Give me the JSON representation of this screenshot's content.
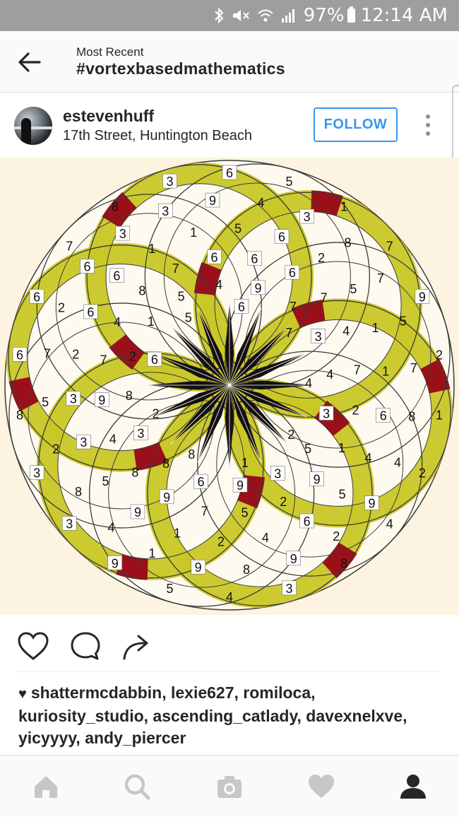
{
  "status_bar": {
    "battery": "97%",
    "time": "12:14 AM",
    "icons": [
      "bluetooth-icon",
      "mute-icon",
      "wifi-icon",
      "signal-icon",
      "battery-icon"
    ]
  },
  "header": {
    "subtitle": "Most Recent",
    "title": "#vortexbasedmathematics",
    "back_icon": "arrow-left-icon"
  },
  "post": {
    "username": "estevenhuff",
    "location": "17th Street, Huntington Beach",
    "follow_label": "FOLLOW",
    "more_icon": "vertical-dots-icon",
    "image": {
      "type": "vortex-math-circle-diagram",
      "colors": {
        "background": "#fcf3e1",
        "yellow": "#c9c726",
        "red": "#9b1018",
        "dark": "#141012",
        "line": "#3a3a3a"
      },
      "numbers": [
        "6",
        "5",
        "1",
        "7",
        "9",
        "2",
        "1",
        "2",
        "4",
        "8",
        "3",
        "4",
        "5",
        "9",
        "3",
        "3",
        "8",
        "6",
        "6",
        "7",
        "8",
        "3",
        "4",
        "3",
        "8",
        "7",
        "5",
        "7",
        "8",
        "4",
        "9",
        "2",
        "9",
        "8",
        "9",
        "1",
        "4",
        "8",
        "2",
        "5",
        "7",
        "2",
        "6",
        "3",
        "3",
        "9",
        "6",
        "2",
        "5",
        "1",
        "1",
        "6",
        "4",
        "5",
        "6",
        "4",
        "2",
        "1",
        "9",
        "5",
        "3",
        "3",
        "2",
        "6",
        "6",
        "1",
        "1",
        "5",
        "6",
        "7",
        "4",
        "7",
        "2",
        "1",
        "9",
        "2",
        "5",
        "7",
        "9",
        "8",
        "4",
        "9",
        "7",
        "4",
        "8",
        "7",
        "6",
        "6",
        "7",
        "3",
        "4",
        "3",
        "5",
        "3",
        "9",
        "6",
        "8",
        "3",
        "8",
        "2",
        "1",
        "5",
        "4",
        "9",
        "7",
        "4",
        "2",
        "1",
        "8",
        "2",
        "6",
        "5",
        "6"
      ]
    }
  },
  "actions": {
    "like_icon": "heart-outline-icon",
    "comment_icon": "comment-bubble-icon",
    "share_icon": "share-arrow-icon"
  },
  "likes_text": "shattermcdabbin, lexie627, romiloca, kuriosity_studio, ascending_catlady, davexnelxve, yicyyyy, andy_piercer",
  "bottom_nav": [
    "home-icon",
    "search-icon",
    "camera-icon",
    "heart-icon",
    "profile-icon"
  ]
}
